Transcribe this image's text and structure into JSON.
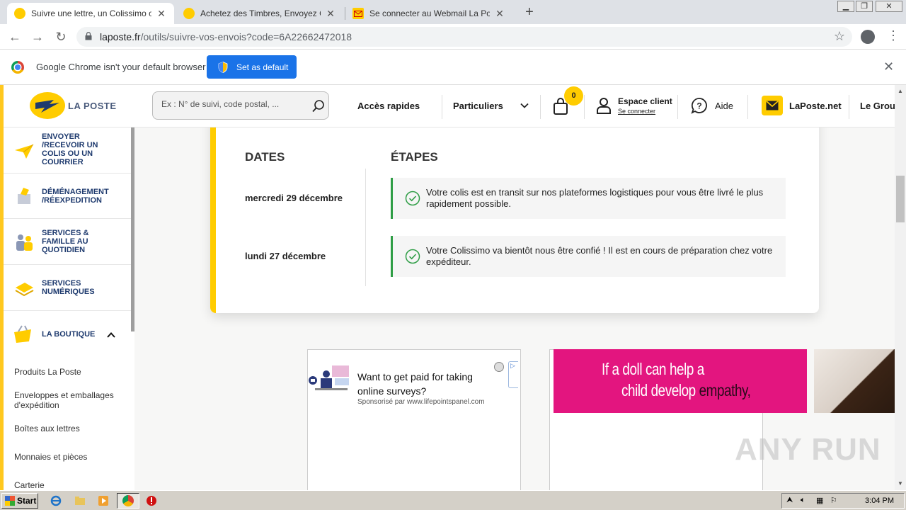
{
  "browser": {
    "tabs": [
      {
        "title": "Suivre une lettre, un Colissimo ou un colis Chronopost | La Poste",
        "active": true
      },
      {
        "title": "Achetez des Timbres, Envoyez Courrier et Colis | La Poste",
        "active": false
      },
      {
        "title": "Se connecter au Webmail La Poste - LaPoste.net",
        "active": false
      }
    ],
    "url_host": "laposte.fr",
    "url_path": "/outils/suivre-vos-envois?code=6A22662472018"
  },
  "infobar": {
    "message": "Google Chrome isn't your default browser",
    "button": "Set as default"
  },
  "header": {
    "logo_text": "LA POSTE",
    "search_placeholder": "Ex : N° de suivi, code postal, ...",
    "acces_rapides": "Accès rapides",
    "particuliers": "Particuliers",
    "cart_count": "0",
    "espace_client": "Espace client",
    "se_connecter": "Se connecter",
    "aide": "Aide",
    "laposte_net": "LaPoste.net",
    "le_groupe": "Le Groupe"
  },
  "sidebar": {
    "categories": [
      {
        "label": "Envoyer /recevoir un colis ou un courrier"
      },
      {
        "label": "Déménagement /réexpedition"
      },
      {
        "label": "Services & famille au quotidien"
      },
      {
        "label": "Services numériques"
      },
      {
        "label": "La boutique"
      }
    ],
    "boutique_items": [
      "Produits La Poste",
      "Enveloppes et emballages d'expédition",
      "Boîtes aux lettres",
      "Monnaies et pièces",
      "Carterie"
    ]
  },
  "tracking": {
    "dates_title": "DATES",
    "steps_title": "ÉTAPES",
    "events": [
      {
        "date": "mercredi 29 décembre",
        "text": "Votre colis est en transit sur nos plateformes logistiques pour vous être livré le plus rapidement possible."
      },
      {
        "date": "lundi 27 décembre",
        "text": "Votre Colissimo va bientôt nous être confié ! Il est en cours de préparation chez votre expéditeur."
      }
    ]
  },
  "ads": {
    "ad1_title": "Want to get paid for taking online surveys?",
    "ad1_sponsor": "Sponsorisé par www.lifepointspanel.com",
    "ad2_line1": "If a doll can help a",
    "ad2_line2_a": "child develop",
    "ad2_line2_b": "empathy,"
  },
  "watermark": "ANY RUN",
  "taskbar": {
    "start": "Start",
    "clock": "3:04 PM"
  },
  "colors": {
    "laposte_yellow": "#ffcc00",
    "laposte_navy": "#1e3a6e",
    "step_green": "#2e9d45",
    "chrome_blue": "#1a73e8"
  }
}
